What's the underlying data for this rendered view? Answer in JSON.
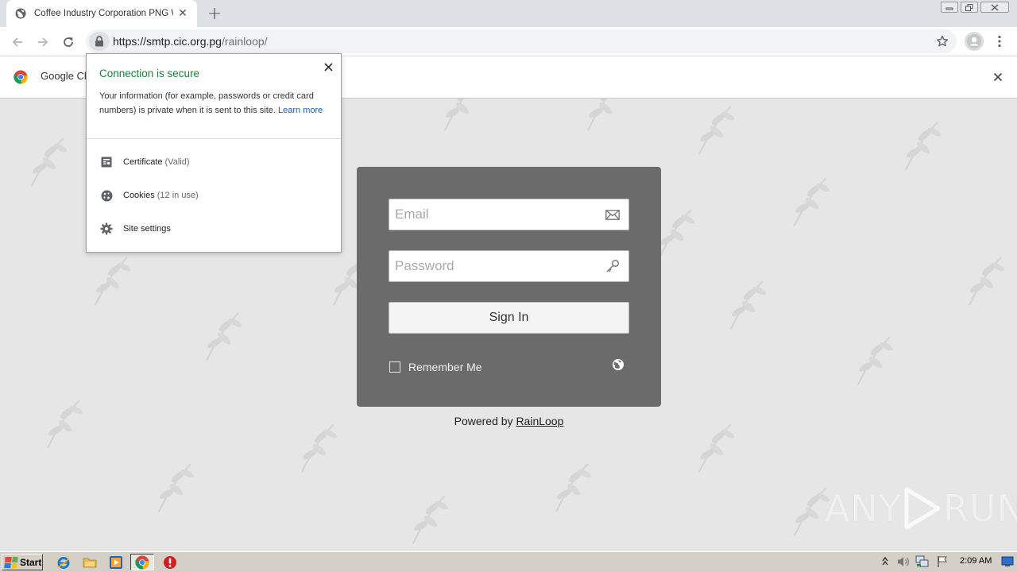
{
  "browser": {
    "tab": {
      "title": "Coffee Industry Corporation PNG W",
      "close": "✕"
    },
    "new_tab": "+",
    "window_controls": {
      "minimize": "▭",
      "restore": "⧉",
      "close": "✕"
    },
    "url": {
      "scheme_host": "https://smtp.cic.org.pg",
      "path": "/rainloop/"
    },
    "icons": [
      "back-arrow-icon",
      "forward-arrow-icon",
      "reload-icon",
      "lock-icon",
      "star-icon",
      "profile-icon",
      "menu-dots-icon"
    ]
  },
  "infobar": {
    "text": "Google Ch",
    "close": "✕"
  },
  "site_info_popup": {
    "title": "Connection is secure",
    "description": "Your information (for example, passwords or credit card numbers) is private when it is sent to this site.",
    "learn_more": "Learn more",
    "rows": [
      {
        "label": "Certificate",
        "detail": "(Valid)",
        "icon": "certificate-icon"
      },
      {
        "label": "Cookies",
        "detail": "(12 in use)",
        "icon": "cookie-icon"
      },
      {
        "label": "Site settings",
        "detail": "",
        "icon": "gear-icon"
      }
    ],
    "accent_color": "#188038"
  },
  "login": {
    "email_placeholder": "Email",
    "password_placeholder": "Password",
    "signin_label": "Sign In",
    "remember_label": "Remember Me",
    "remember_checked": false,
    "powered_prefix": "Powered by ",
    "powered_link": "RainLoop",
    "card_color": "#6b6b6b"
  },
  "watermark": {
    "left": "ANY",
    "right": "RUN"
  },
  "taskbar": {
    "start_label": "Start",
    "apps": [
      "internet-explorer-icon",
      "folder-icon",
      "media-player-icon",
      "chrome-icon",
      "antivirus-icon"
    ],
    "clock": "2:09 AM"
  }
}
